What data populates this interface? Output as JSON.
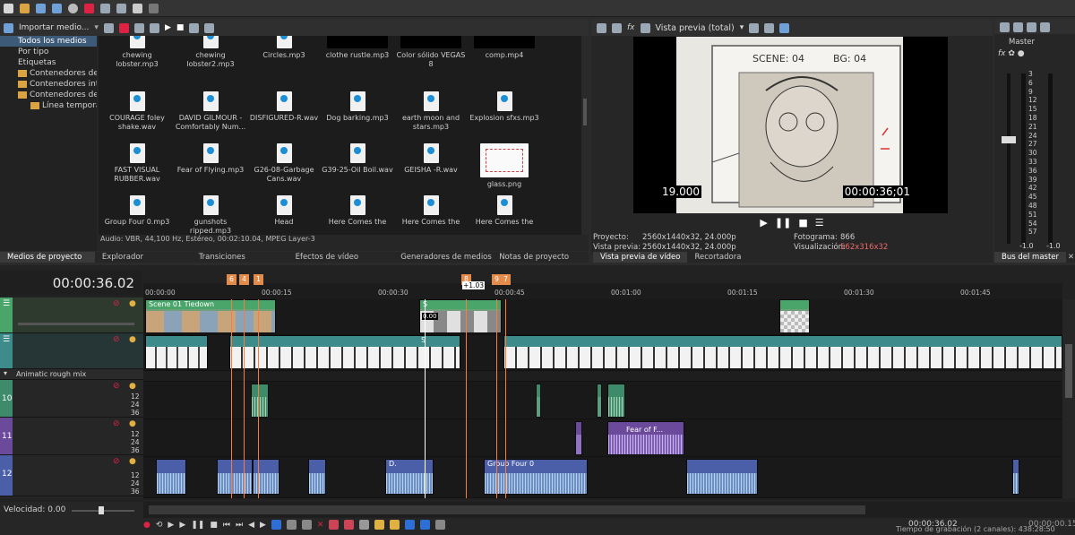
{
  "explorer": {
    "import_label": "Importar medio...",
    "tree": [
      {
        "label": "Todos los medios",
        "indent": 20,
        "selected": true
      },
      {
        "label": "Por tipo",
        "indent": 20
      },
      {
        "label": "Etiquetas",
        "indent": 20
      },
      {
        "label": "Contenedores de m",
        "indent": 20,
        "folder": true
      },
      {
        "label": "Contenedores intelig",
        "indent": 20,
        "folder": true
      },
      {
        "label": "Contenedores de St",
        "indent": 20,
        "folder": true
      },
      {
        "label": "Línea temporal",
        "indent": 34,
        "folder": true
      }
    ],
    "media": [
      {
        "name": "chewing lobster.mp3",
        "type": "mp3"
      },
      {
        "name": "chewing lobster2.mp3",
        "type": "mp3"
      },
      {
        "name": "Circles.mp3",
        "type": "mp3"
      },
      {
        "name": "clothe rustle.mp3",
        "type": "black"
      },
      {
        "name": "Color sólido VEGAS 8",
        "type": "black"
      },
      {
        "name": "comp.mp4",
        "type": "black"
      },
      {
        "name": "COURAGE foley shake.wav",
        "type": "wav"
      },
      {
        "name": "DAVID GILMOUR - Comfortably Num...",
        "type": "mp3"
      },
      {
        "name": "DISFIGURED-R.wav",
        "type": "wav"
      },
      {
        "name": "Dog barking.mp3",
        "type": "mp3"
      },
      {
        "name": "earth moon and stars.mp3",
        "type": "mp3"
      },
      {
        "name": "Explosion sfxs.mp3",
        "type": "mp3"
      },
      {
        "name": "FAST VISUAL RUBBER.wav",
        "type": "wav"
      },
      {
        "name": "Fear of Flying.mp3",
        "type": "mp3"
      },
      {
        "name": "G26-08-Garbage Cans.wav",
        "type": "wav"
      },
      {
        "name": "G39-25-Oil Boil.wav",
        "type": "wav"
      },
      {
        "name": "GEISHA    -R.wav",
        "type": "wav"
      },
      {
        "name": "glass.png",
        "type": "png"
      },
      {
        "name": "Group Four 0.mp3",
        "type": "mp3"
      },
      {
        "name": "gunshots ripped.mp3",
        "type": "mp3"
      },
      {
        "name": "Head",
        "type": "mp3"
      },
      {
        "name": "Here Comes the",
        "type": "mp3"
      },
      {
        "name": "Here Comes the",
        "type": "mp3"
      },
      {
        "name": "Here Comes the",
        "type": "mp3"
      }
    ],
    "status": "Audio: VBR, 44,100 Hz, Estéreo, 00:02:10.04, MPEG Layer-3",
    "tabs": [
      "Medios de proyecto",
      "Explorador",
      "Transiciones",
      "Efectos de vídeo",
      "Generadores de medios",
      "Notas de proyecto"
    ]
  },
  "preview": {
    "mode_label": "Vista previa (total)",
    "left_tc": "19.000",
    "right_tc": "00:00:36;01",
    "proyecto_label": "Proyecto:",
    "proyecto_val": "2560x1440x32, 24.000p",
    "vista_label": "Vista previa:",
    "vista_val": "2560x1440x32, 24.000p",
    "fotograma_label": "Fotograma:",
    "fotograma_val": "866",
    "visual_label": "Visualización:",
    "visual_val": "562x316x32",
    "tabs": [
      "Vista previa de vídeo",
      "Recortadora"
    ]
  },
  "master": {
    "label": "Master",
    "ticks": [
      "3",
      "6",
      "9",
      "12",
      "15",
      "18",
      "21",
      "24",
      "27",
      "30",
      "33",
      "36",
      "39",
      "42",
      "45",
      "48",
      "51",
      "54",
      "57"
    ],
    "left_val": "-1.0",
    "right_val": "-1.0",
    "tab": "Bus del master"
  },
  "timeline": {
    "timecode": "00:00:36.02",
    "ruler": [
      "00:00:00",
      "00:00:15",
      "00:00:30",
      "00:00:45",
      "00:01:00",
      "00:01:15",
      "00:01:30",
      "00:01:45"
    ],
    "markers": [
      "6",
      "4",
      "1",
      "8",
      "9",
      "7"
    ],
    "region_label": "+1.03",
    "bus_label": "Animatic rough mix",
    "track_nums": [
      "10",
      "11",
      "12"
    ],
    "db_labels": [
      "12",
      "24",
      "36"
    ],
    "clips": {
      "scene": "Scene 01 Tiedown",
      "s_label": "S",
      "fear": "Fear of F...",
      "d_label": "D.",
      "group": "Group Four 0",
      "small_tc": "0.00"
    },
    "velocidad": "Velocidad: 0.00",
    "tc_bottom": "00:00:36.02",
    "tc_bottom2": "00:00:00.15",
    "rec_time": "Tiempo de grabación (2 canales): 438:28:50"
  }
}
